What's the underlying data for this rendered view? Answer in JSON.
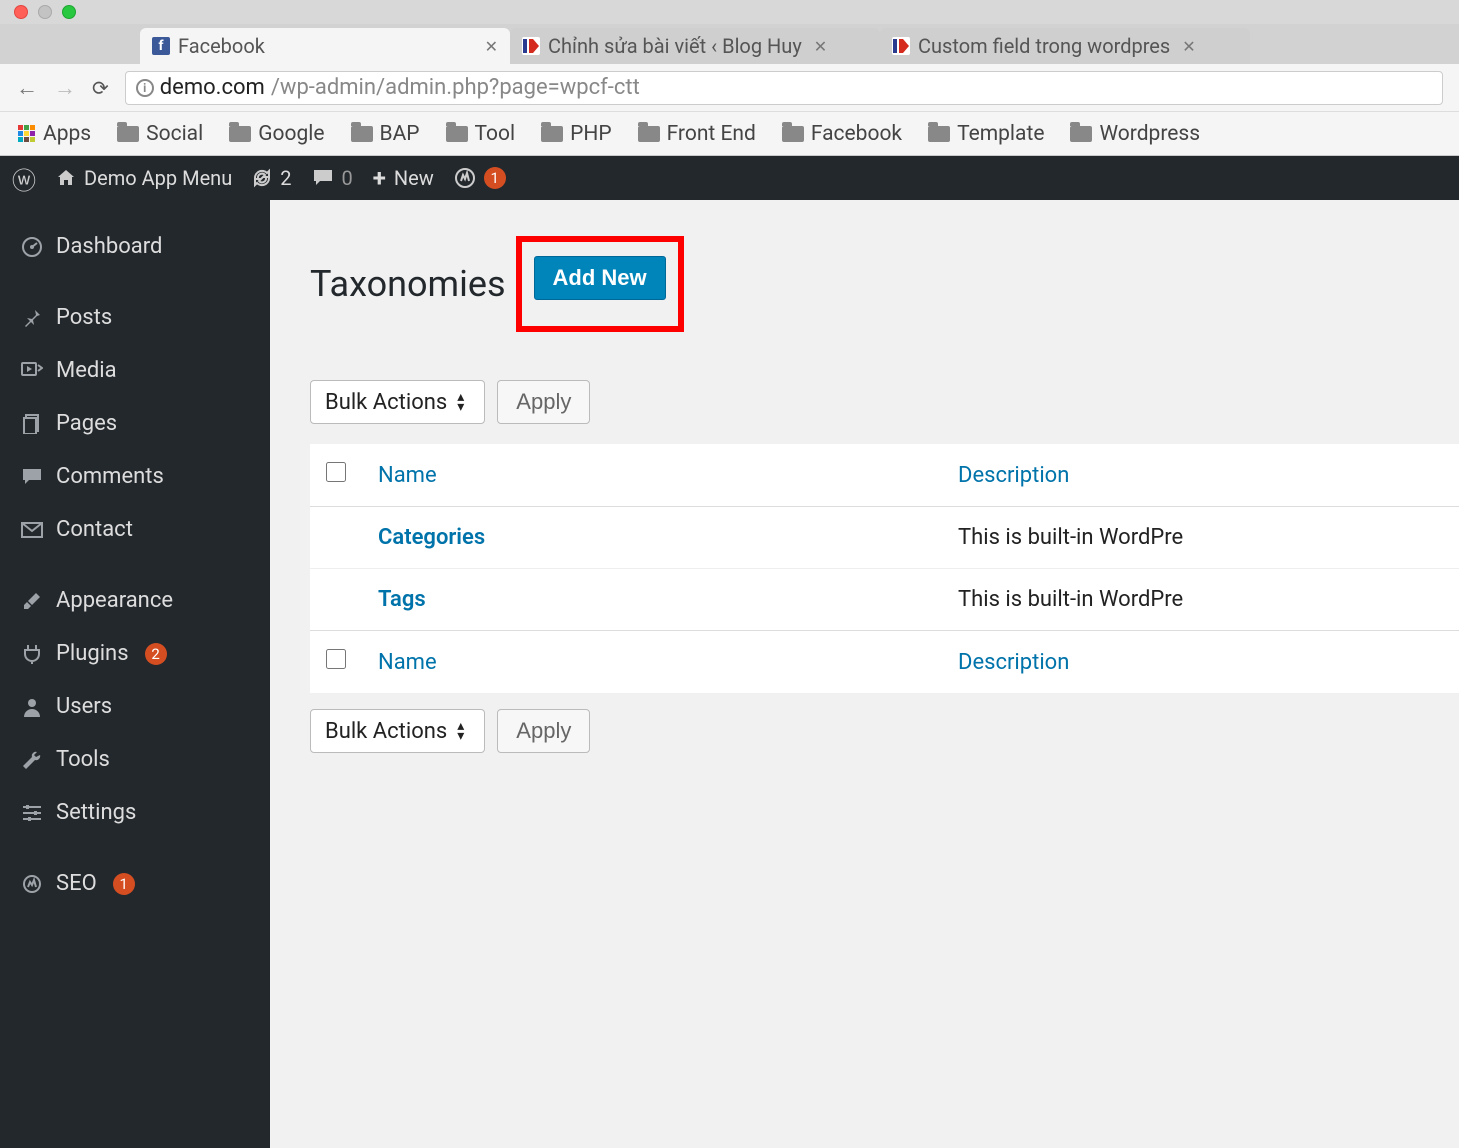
{
  "browser": {
    "tabs": [
      {
        "title": "Facebook",
        "active": true
      },
      {
        "title": "Chỉnh sửa bài viết ‹ Blog Huy",
        "active": false
      },
      {
        "title": "Custom field trong wordpres",
        "active": false
      }
    ],
    "url_host": "demo.com",
    "url_path": "/wp-admin/admin.php?page=wpcf-ctt",
    "bookmarks_label_apps": "Apps",
    "bookmarks": [
      "Social",
      "Google",
      "BAP",
      "Tool",
      "PHP",
      "Front End",
      "Facebook",
      "Template",
      "Wordpress"
    ]
  },
  "wp_bar": {
    "site_name": "Demo App Menu",
    "updates": "2",
    "comments": "0",
    "new_label": "New",
    "seo_badge": "1"
  },
  "sidebar": {
    "items": [
      {
        "icon": "dashboard",
        "label": "Dashboard"
      },
      {
        "icon": "pin",
        "label": "Posts"
      },
      {
        "icon": "media",
        "label": "Media"
      },
      {
        "icon": "pages",
        "label": "Pages"
      },
      {
        "icon": "comment",
        "label": "Comments"
      },
      {
        "icon": "mail",
        "label": "Contact"
      },
      {
        "icon": "brush",
        "label": "Appearance"
      },
      {
        "icon": "plug",
        "label": "Plugins",
        "badge": "2"
      },
      {
        "icon": "user",
        "label": "Users"
      },
      {
        "icon": "wrench",
        "label": "Tools"
      },
      {
        "icon": "sliders",
        "label": "Settings"
      },
      {
        "icon": "seo",
        "label": "SEO",
        "badge": "1"
      }
    ]
  },
  "page": {
    "title": "Taxonomies",
    "add_new": "Add New",
    "bulk_actions": "Bulk Actions",
    "apply": "Apply",
    "col_name": "Name",
    "col_description": "Description",
    "rows": [
      {
        "name": "Categories",
        "description": "This is built-in WordPre"
      },
      {
        "name": "Tags",
        "description": "This is built-in WordPre"
      }
    ]
  }
}
